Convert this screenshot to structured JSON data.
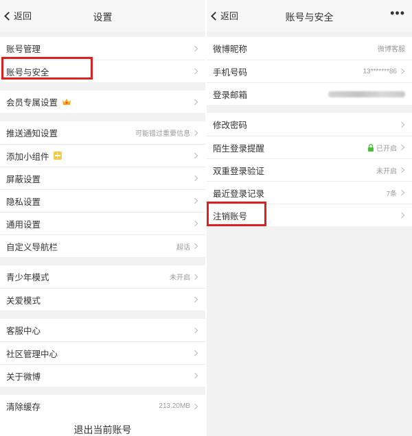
{
  "left": {
    "back": "返回",
    "title": "设置",
    "groups": [
      [
        {
          "label": "账号管理"
        },
        {
          "label": "账号与安全"
        }
      ],
      [
        {
          "label": "会员专属设置"
        }
      ],
      [
        {
          "label": "推送通知设置",
          "value": "可能错过重要信息"
        },
        {
          "label": "添加小组件"
        },
        {
          "label": "屏蔽设置"
        },
        {
          "label": "隐私设置"
        },
        {
          "label": "通用设置"
        },
        {
          "label": "自定义导航栏",
          "value": "超话"
        }
      ],
      [
        {
          "label": "青少年模式",
          "value": "未开启"
        },
        {
          "label": "关爱模式"
        }
      ],
      [
        {
          "label": "客服中心"
        },
        {
          "label": "社区管理中心"
        },
        {
          "label": "关于微博"
        }
      ],
      [
        {
          "label": "清除缓存",
          "value": "213.20MB"
        }
      ]
    ],
    "logout": "退出当前账号"
  },
  "right": {
    "back": "返回",
    "title": "账号与安全",
    "more": "•••",
    "groups": [
      [
        {
          "label": "微博昵称",
          "value": "微博客服"
        },
        {
          "label": "手机号码",
          "value": "13*******86"
        },
        {
          "label": "登录邮箱"
        }
      ],
      [
        {
          "label": "修改密码"
        },
        {
          "label": "陌生登录提醒",
          "value": "已开启"
        },
        {
          "label": "双重登录验证",
          "value": "未开启"
        },
        {
          "label": "最近登录记录",
          "value": "7条"
        },
        {
          "label": "注销账号"
        }
      ]
    ]
  },
  "colors": {
    "highlight": "#d92121",
    "background": "#f2f2f2",
    "lock_green": "#4cbf3a",
    "crown_orange": "#f5a623",
    "widget_yellow": "#f2c94c"
  }
}
